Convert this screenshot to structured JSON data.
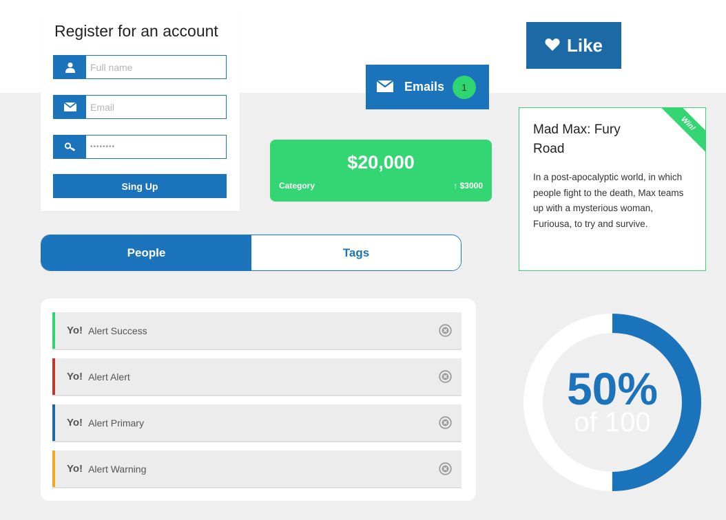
{
  "register": {
    "title": "Register for an account",
    "fullname_placeholder": "Full name",
    "email_placeholder": "Email",
    "password_value": "••••••••",
    "signup_label": "Sing Up"
  },
  "emails": {
    "label": "Emails",
    "count": "1"
  },
  "like": {
    "label": "Like"
  },
  "stat": {
    "value": "$20,000",
    "category": "Category",
    "change": "↑ $3000"
  },
  "movie": {
    "ribbon": "Win!",
    "title": "Mad Max: Fury Road",
    "description": "In a post-apocalyptic world, in which people fight to the death, Max teams up with a mysterious woman, Furiousa, to try and survive."
  },
  "tabs": [
    {
      "label": "People",
      "active": true
    },
    {
      "label": "Tags",
      "active": false
    }
  ],
  "alerts": [
    {
      "prefix": "Yo!",
      "message": "Alert Success",
      "color": "#2ed671"
    },
    {
      "prefix": "Yo!",
      "message": "Alert Alert",
      "color": "#c0392b"
    },
    {
      "prefix": "Yo!",
      "message": "Alert Primary",
      "color": "#1b6aa6"
    },
    {
      "prefix": "Yo!",
      "message": "Alert Warning",
      "color": "#f5a623"
    }
  ],
  "progress": {
    "value": 50,
    "label": "50%",
    "sub_label": "of 100"
  },
  "colors": {
    "primary": "#1b73bb",
    "success": "#33d672",
    "background": "#efefef"
  },
  "icons": {
    "fullname": "user-icon",
    "email": "envelope-icon",
    "password": "key-icon",
    "like": "heart-icon",
    "alert_close": "close-circle-icon"
  }
}
